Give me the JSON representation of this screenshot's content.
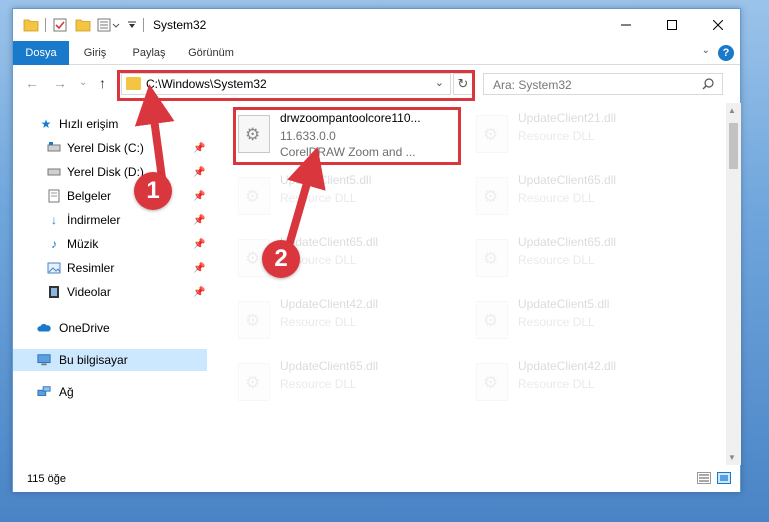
{
  "window": {
    "title": "System32"
  },
  "ribbon": {
    "tabs": [
      "Dosya",
      "Giriş",
      "Paylaş",
      "Görünüm"
    ],
    "help_label": "?"
  },
  "nav": {
    "address": "C:\\Windows\\System32",
    "search_placeholder": "Ara: System32"
  },
  "sidebar": {
    "items": [
      {
        "label": "Hızlı erişim",
        "icon": "star-icon"
      },
      {
        "label": "Yerel Disk (C:)",
        "icon": "drive-icon"
      },
      {
        "label": "Yerel Disk (D:)",
        "icon": "drive-icon"
      },
      {
        "label": "Belgeler",
        "icon": "document-icon"
      },
      {
        "label": "İndirmeler",
        "icon": "download-icon"
      },
      {
        "label": "Müzik",
        "icon": "music-icon"
      },
      {
        "label": "Resimler",
        "icon": "pictures-icon"
      },
      {
        "label": "Videolar",
        "icon": "video-icon"
      },
      {
        "label": "OneDrive",
        "icon": "cloud-icon"
      },
      {
        "label": "Bu bilgisayar",
        "icon": "computer-icon"
      },
      {
        "label": "Ağ",
        "icon": "network-icon"
      }
    ]
  },
  "files": [
    {
      "name": "drwzoompantoolcore110...",
      "version": "11.633.0.0",
      "desc": "CorelDRAW Zoom and ..."
    },
    {
      "name": "UpdateClient21.dll",
      "version": "Resource DLL",
      "desc": ""
    },
    {
      "name": "UpdateClient5.dll",
      "version": "Resource DLL",
      "desc": ""
    },
    {
      "name": "UpdateClient65.dll",
      "version": "Resource DLL",
      "desc": ""
    },
    {
      "name": "UpdateClient65.dll",
      "version": "Resource DLL",
      "desc": ""
    },
    {
      "name": "UpdateClient65.dll",
      "version": "Resource DLL",
      "desc": ""
    },
    {
      "name": "UpdateClient42.dll",
      "version": "Resource DLL",
      "desc": ""
    },
    {
      "name": "UpdateClient5.dll",
      "version": "Resource DLL",
      "desc": ""
    },
    {
      "name": "UpdateClient65.dll",
      "version": "Resource DLL",
      "desc": ""
    },
    {
      "name": "UpdateClient42.dll",
      "version": "Resource DLL",
      "desc": ""
    }
  ],
  "status": {
    "count": "115 öğe"
  },
  "callouts": {
    "one": "1",
    "two": "2"
  },
  "colors": {
    "accent": "#1979ca",
    "highlight": "#d9363e",
    "selected": "#cce8ff"
  }
}
